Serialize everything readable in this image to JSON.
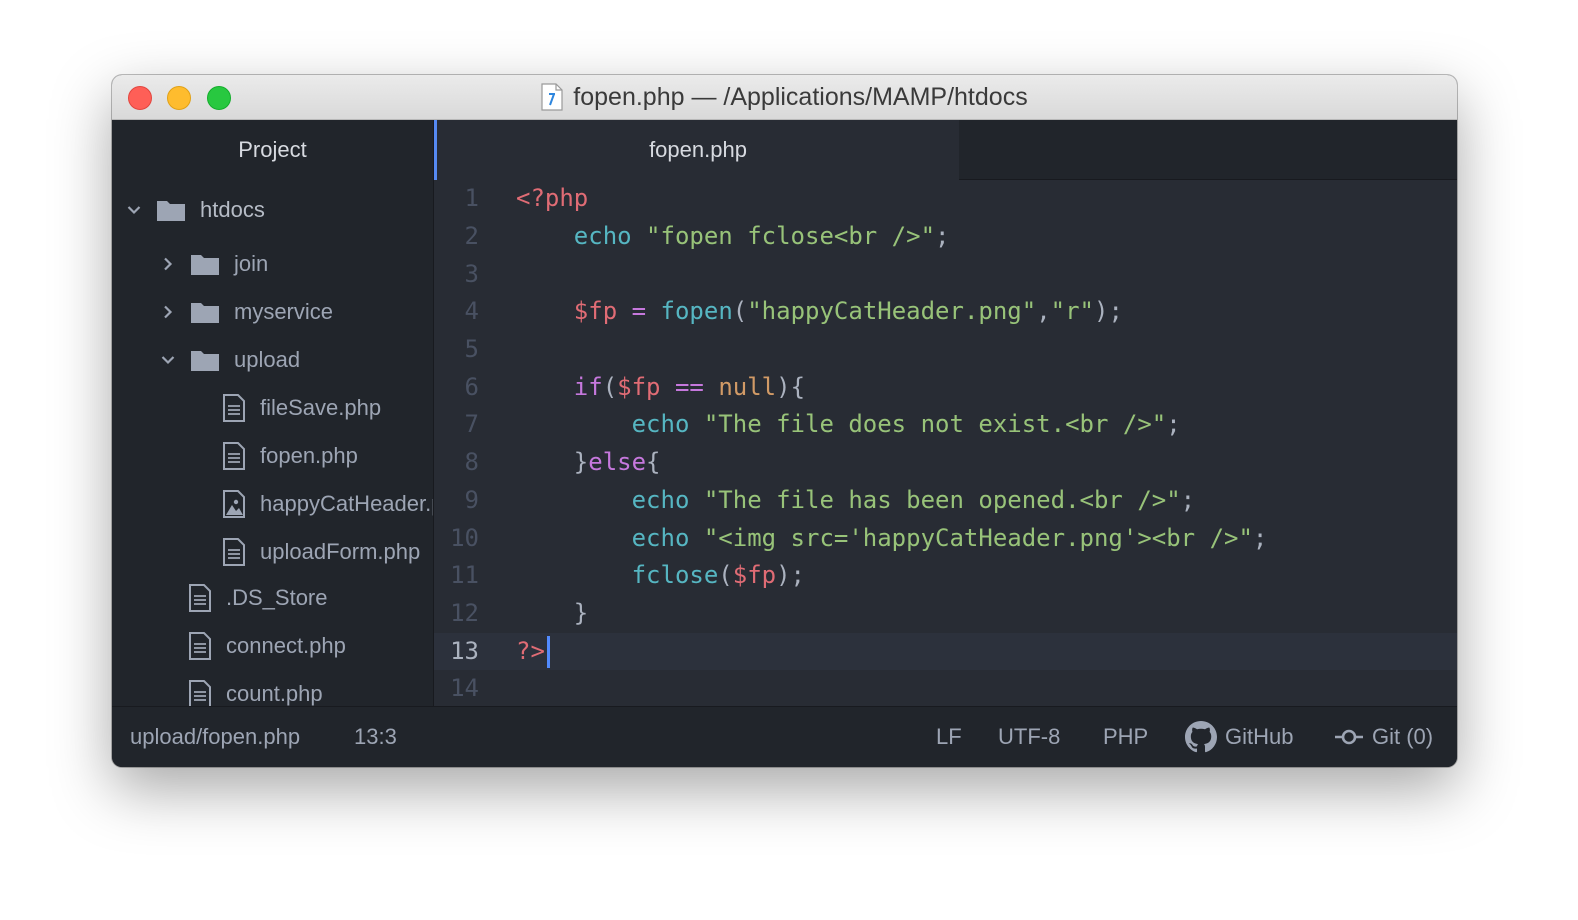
{
  "window": {
    "title": "fopen.php — /Applications/MAMP/htdocs"
  },
  "sidebar": {
    "header": "Project",
    "root": "htdocs",
    "items": [
      {
        "label": "join",
        "type": "folder",
        "state": "collapsed"
      },
      {
        "label": "myservice",
        "type": "folder",
        "state": "collapsed"
      },
      {
        "label": "upload",
        "type": "folder",
        "state": "expanded"
      },
      {
        "label": "fileSave.php",
        "type": "file"
      },
      {
        "label": "fopen.php",
        "type": "file"
      },
      {
        "label": "happyCatHeader.png",
        "type": "image"
      },
      {
        "label": "uploadForm.php",
        "type": "file"
      },
      {
        "label": ".DS_Store",
        "type": "file"
      },
      {
        "label": "connect.php",
        "type": "file"
      },
      {
        "label": "count.php",
        "type": "file"
      }
    ]
  },
  "editor": {
    "tab": "fopen.php",
    "line_numbers": [
      "1",
      "2",
      "3",
      "4",
      "5",
      "6",
      "7",
      "8",
      "9",
      "10",
      "11",
      "12",
      "13",
      "14"
    ],
    "cursor_line": 13
  },
  "statusbar": {
    "path": "upload/fopen.php",
    "position": "13:3",
    "line_ending": "LF",
    "encoding": "UTF-8",
    "grammar": "PHP",
    "github": "GitHub",
    "git": "Git (0)"
  },
  "colors": {
    "accent": "#568af2",
    "tag": "#e06c75",
    "function": "#56b6c2",
    "string": "#98c379",
    "keyword": "#c678dd",
    "constant": "#d19a66"
  },
  "icons": {
    "window": "php-file-icon",
    "folder": "folder-icon",
    "file": "file-text-icon",
    "image": "file-image-icon",
    "github": "github-icon",
    "git": "git-commit-icon"
  }
}
